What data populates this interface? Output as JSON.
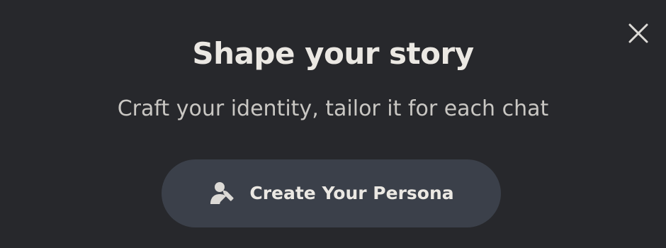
{
  "dialog": {
    "title": "Shape your story",
    "subtitle": "Craft your identity, tailor it for each chat",
    "cta_label": "Create Your Persona",
    "close_icon": "close-icon",
    "cta_icon": "user-edit-icon"
  },
  "colors": {
    "background": "#27282c",
    "button_background": "#3b404a",
    "text_primary": "#ebe8e3",
    "text_secondary": "#c9c7c3",
    "icon": "#dcdad6"
  }
}
